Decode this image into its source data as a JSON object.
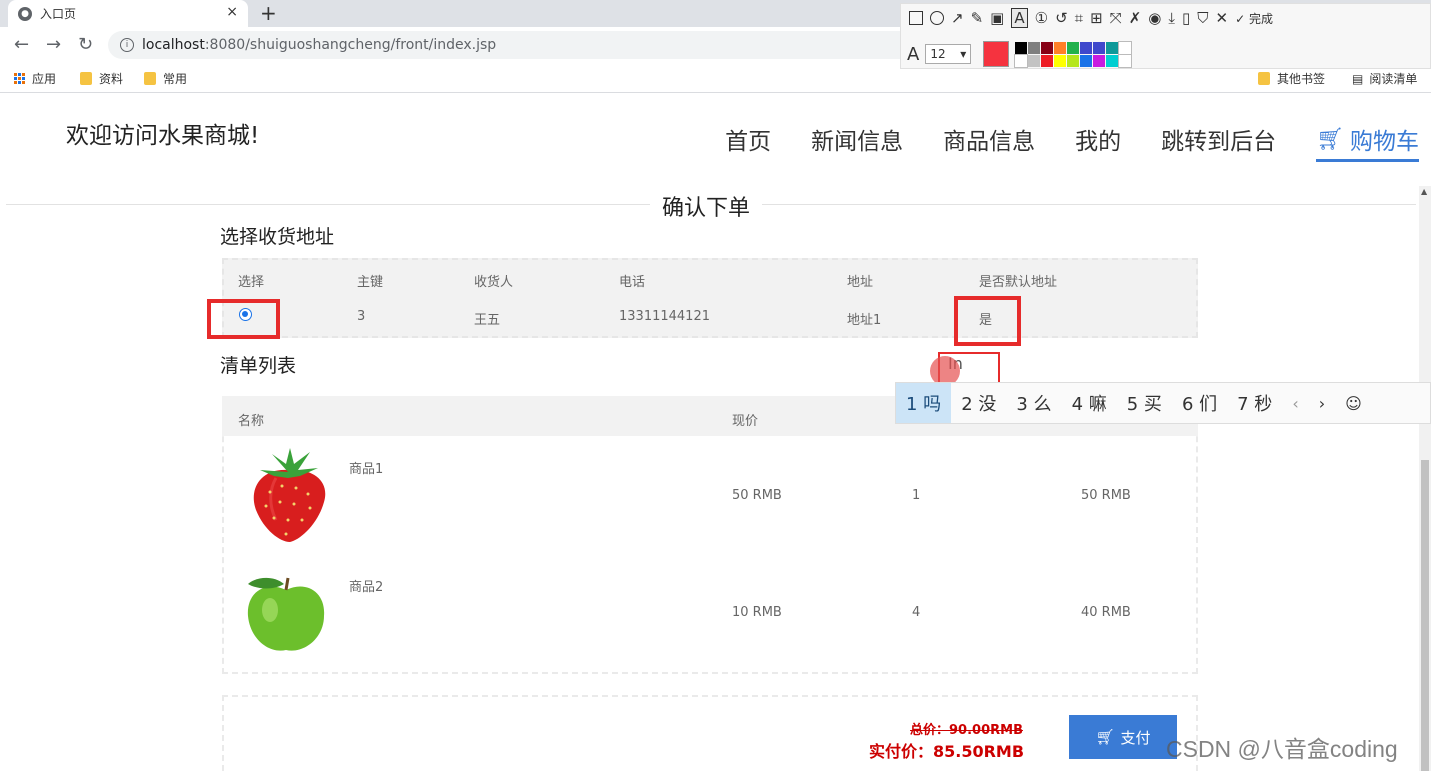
{
  "browser": {
    "tab_title": "入口页",
    "url_host": "localhost",
    "url_path": ":8080/shuiguoshangcheng/front/index.jsp",
    "bookmarks": [
      "应用",
      "资料",
      "常用"
    ],
    "bookmarks_right": [
      "其他书签",
      "阅读清单"
    ]
  },
  "snap_tool": {
    "done_label": "完成",
    "font_size": "12",
    "current_color": "#f5333f",
    "palette": [
      "#000000",
      "#7f7f7f",
      "#880015",
      "#ff7f27",
      "#22b14c",
      "#3f48cc",
      "#3f48cc",
      "#0e9999",
      "#ffffff",
      "#ffffff",
      "#c3c3c3",
      "#ed1c24",
      "#ffff00",
      "#b5e61d",
      "#1a73e8",
      "#c71be0",
      "#00ced1",
      "#ffffff"
    ]
  },
  "site": {
    "title": "欢迎访问水果商城!",
    "nav": [
      "首页",
      "新闻信息",
      "商品信息",
      "我的",
      "跳转到后台"
    ],
    "cart_label": "购物车",
    "accent": "#3a7bd5"
  },
  "order": {
    "section_title": "确认下单",
    "address_title": "选择收货地址",
    "address_headers": [
      "选择",
      "主键",
      "收货人",
      "电话",
      "地址",
      "是否默认地址"
    ],
    "address_row": {
      "id": "3",
      "name": "王五",
      "phone": "13311144121",
      "address": "地址1",
      "is_default": "是"
    },
    "list_title": "清单列表",
    "item_header_name": "名称",
    "item_header_price": "现价",
    "items": [
      {
        "name": "商品1",
        "price": "50 RMB",
        "qty": "1",
        "subtotal": "50 RMB",
        "icon": "strawberry-icon"
      },
      {
        "name": "商品2",
        "price": "10 RMB",
        "qty": "4",
        "subtotal": "40 RMB",
        "icon": "apple-icon"
      }
    ],
    "total_label": "总价：90.00RMB",
    "real_label": "实付价：85.50RMB",
    "pay_label": "支付"
  },
  "ime": {
    "composition": "In",
    "candidates": [
      "1 吗",
      "2 没",
      "3 么",
      "4 嘛",
      "5 买",
      "6 们",
      "7 秒"
    ]
  },
  "watermark": "CSDN @八音盒coding"
}
